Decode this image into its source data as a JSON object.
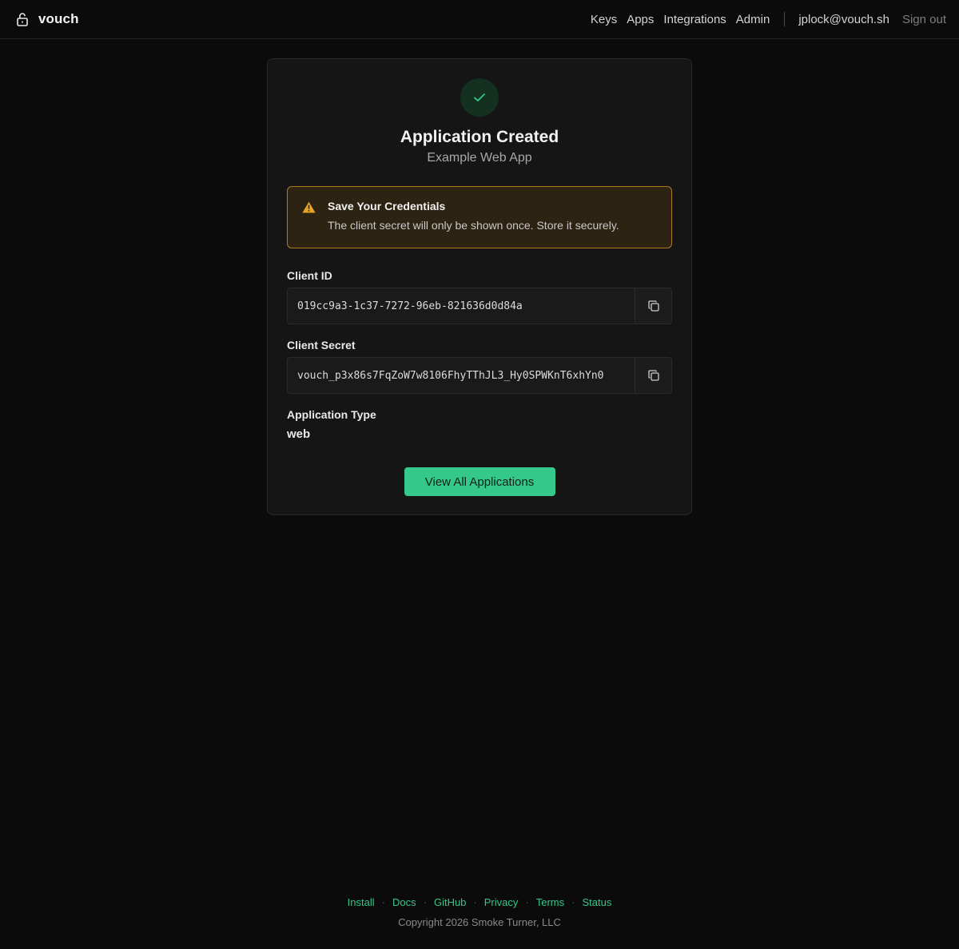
{
  "header": {
    "brand": "vouch",
    "nav": [
      "Keys",
      "Apps",
      "Integrations",
      "Admin"
    ],
    "user_email": "jplock@vouch.sh",
    "sign_out": "Sign out"
  },
  "card": {
    "title": "Application Created",
    "subtitle": "Example Web App",
    "alert": {
      "title": "Save Your Credentials",
      "message": "The client secret will only be shown once. Store it securely."
    },
    "client_id": {
      "label": "Client ID",
      "value": "019cc9a3-1c37-7272-96eb-821636d0d84a"
    },
    "client_secret": {
      "label": "Client Secret",
      "value": "vouch_p3x86s7FqZoW7w8106FhyTThJL3_Hy0SPWKnT6xhYn0"
    },
    "app_type": {
      "label": "Application Type",
      "value": "web"
    },
    "primary_button": "View All Applications"
  },
  "footer": {
    "links": [
      "Install",
      "Docs",
      "GitHub",
      "Privacy",
      "Terms",
      "Status"
    ],
    "separator": "·",
    "copyright": "Copyright 2026 Smoke Turner, LLC"
  },
  "colors": {
    "accent": "#34c98a",
    "warning_border": "#b07a1e",
    "warning_bg": "#2c2312",
    "background": "#0b0b0b"
  },
  "icons": {
    "brand": "lock-icon",
    "success": "check-icon",
    "alert": "warning-triangle-icon",
    "copy": "copy-icon"
  }
}
